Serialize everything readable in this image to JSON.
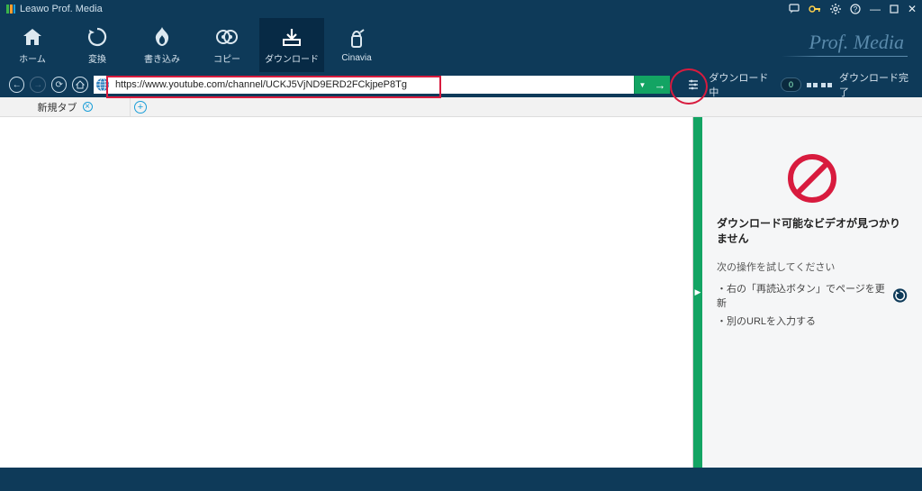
{
  "title": "Leawo Prof. Media",
  "brand": "Prof. Media",
  "toolbar": {
    "home": "ホーム",
    "convert": "変換",
    "burn": "書き込み",
    "copy": "コピー",
    "download": "ダウンロード",
    "cinavia": "Cinavia"
  },
  "url": "https://www.youtube.com/channel/UCKJ5VjND9ERD2FCkjpeP8Tg",
  "status": {
    "downloading_label": "ダウンロード中",
    "downloading_count": "0",
    "done_label": "ダウンロード完了"
  },
  "tab": {
    "label": "新規タブ"
  },
  "panel": {
    "heading": "ダウンロード可能なビデオが見つかりません",
    "hint": "次の操作を試してください",
    "line1": "・右の「再読込ボタン」でページを更新",
    "line2": "・別のURLを入力する"
  }
}
